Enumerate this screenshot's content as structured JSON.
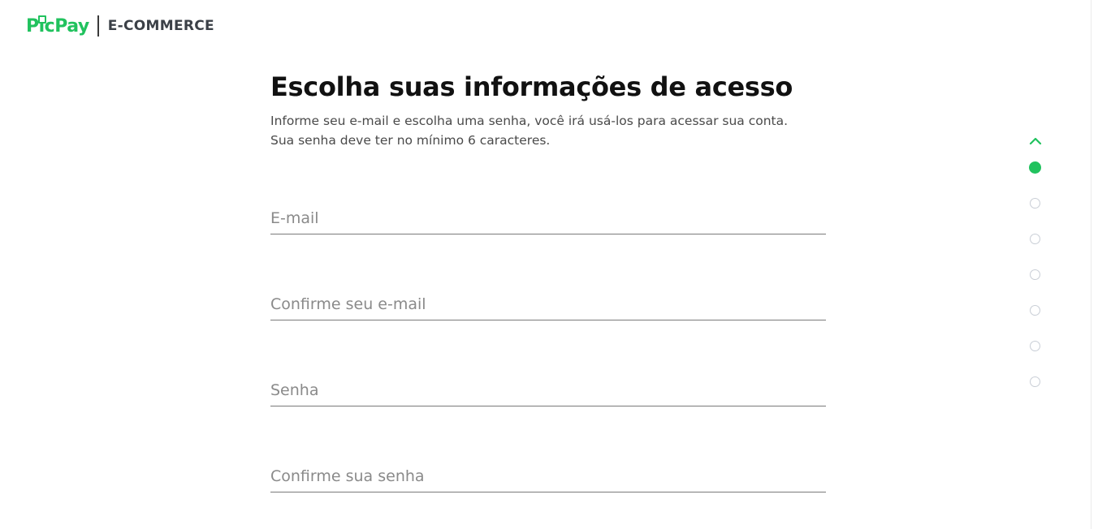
{
  "header": {
    "brand": "PicPay",
    "suffix": "E-COMMERCE"
  },
  "main": {
    "title": "Escolha suas informações de acesso",
    "subtitle_line1": "Informe seu e-mail e escolha uma senha, você irá usá-los para acessar sua conta.",
    "subtitle_line2": "Sua senha deve ter no mínimo 6 caracteres.",
    "fields": [
      {
        "placeholder": "E-mail",
        "value": ""
      },
      {
        "placeholder": "Confirme seu e-mail",
        "value": ""
      },
      {
        "placeholder": "Senha",
        "value": ""
      },
      {
        "placeholder": "Confirme sua senha",
        "value": ""
      }
    ]
  },
  "stepper": {
    "up_icon": "chevron-up-icon",
    "total_steps": 7,
    "current_step": 1
  },
  "colors": {
    "brand_green": "#21c25e",
    "title": "#111111",
    "subtitle": "#4a4a4a",
    "placeholder": "#8a8a8a",
    "inactive_dot": "#c9ced6"
  }
}
